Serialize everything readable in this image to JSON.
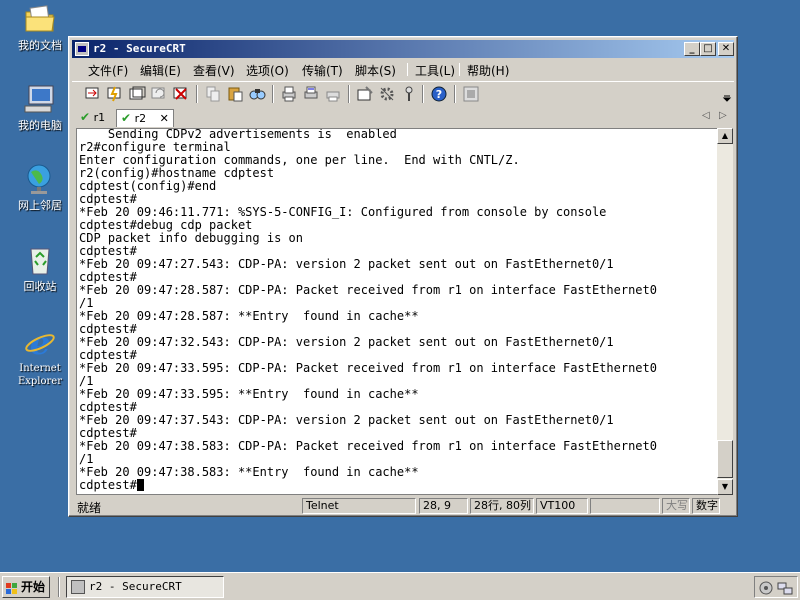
{
  "desktop": {
    "icons": [
      {
        "label": "我的文档"
      },
      {
        "label": "我的电脑"
      },
      {
        "label": "网上邻居"
      },
      {
        "label": "回收站"
      },
      {
        "label": "Internet Explorer"
      }
    ]
  },
  "window": {
    "title": "r2 - SecureCRT",
    "controls": {
      "minimize": "_",
      "maximize": "□",
      "close": "✕"
    }
  },
  "menu": [
    "文件(F)",
    "编辑(E)",
    "查看(V)",
    "选项(O)",
    "传输(T)",
    "脚本(S)",
    "工具(L)",
    "帮助(H)"
  ],
  "tabs": [
    {
      "label": "r1",
      "check": "✔"
    },
    {
      "label": "r2",
      "check": "✔",
      "close": "✕"
    }
  ],
  "tab_nav": {
    "prev": "◁",
    "next": "▷"
  },
  "terminal": {
    "lines": [
      "    Sending CDPv2 advertisements is  enabled",
      "r2#configure terminal",
      "Enter configuration commands, one per line.  End with CNTL/Z.",
      "r2(config)#hostname cdptest",
      "cdptest(config)#end",
      "cdptest#",
      "*Feb 20 09:46:11.771: %SYS-5-CONFIG_I: Configured from console by console",
      "cdptest#debug cdp packet",
      "CDP packet info debugging is on",
      "cdptest#",
      "*Feb 20 09:47:27.543: CDP-PA: version 2 packet sent out on FastEthernet0/1",
      "cdptest#",
      "*Feb 20 09:47:28.587: CDP-PA: Packet received from r1 on interface FastEthernet0",
      "/1",
      "*Feb 20 09:47:28.587: **Entry  found in cache**",
      "cdptest#",
      "*Feb 20 09:47:32.543: CDP-PA: version 2 packet sent out on FastEthernet0/1",
      "cdptest#",
      "*Feb 20 09:47:33.595: CDP-PA: Packet received from r1 on interface FastEthernet0",
      "/1",
      "*Feb 20 09:47:33.595: **Entry  found in cache**",
      "cdptest#",
      "*Feb 20 09:47:37.543: CDP-PA: version 2 packet sent out on FastEthernet0/1",
      "cdptest#",
      "*Feb 20 09:47:38.583: CDP-PA: Packet received from r1 on interface FastEthernet0",
      "/1",
      "*Feb 20 09:47:38.583: **Entry  found in cache**"
    ],
    "prompt": "cdptest#"
  },
  "scrollbar": {
    "up": "▲",
    "down": "▼"
  },
  "status": {
    "ready": "就绪",
    "protocol": "Telnet",
    "position": "28,  9",
    "size": "28行, 80列",
    "emulation": "VT100",
    "blank": "",
    "caps": "大写",
    "num": "数字"
  },
  "taskbar": {
    "start_label": "开始",
    "task_label": "r2 - SecureCRT"
  },
  "colors": {
    "desktop": "#3a6ea5",
    "titlebar_start": "#0a246a",
    "titlebar_end": "#a6caf0"
  }
}
